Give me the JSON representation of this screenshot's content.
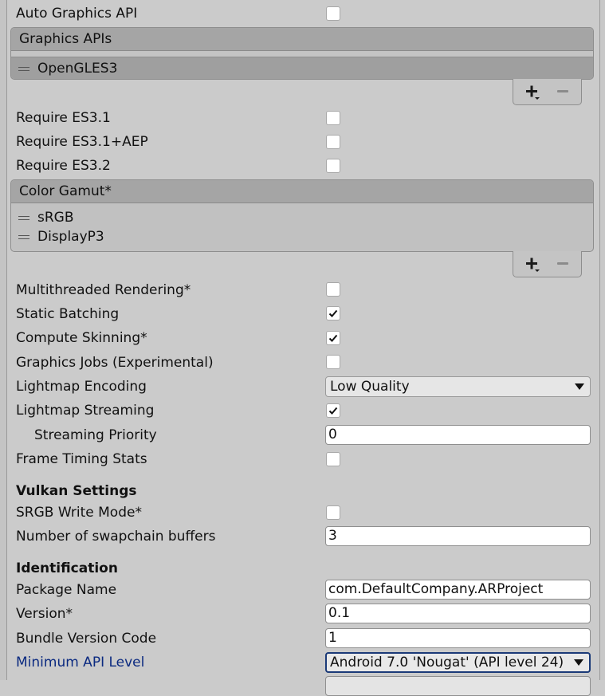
{
  "rows": {
    "auto_graphics_api": {
      "label": "Auto Graphics API",
      "checked": false
    },
    "require_es31": {
      "label": "Require ES3.1",
      "checked": false
    },
    "require_es31_aep": {
      "label": "Require ES3.1+AEP",
      "checked": false
    },
    "require_es32": {
      "label": "Require ES3.2",
      "checked": false
    },
    "multithreaded_rendering": {
      "label": "Multithreaded Rendering*",
      "checked": false
    },
    "static_batching": {
      "label": "Static Batching",
      "checked": true
    },
    "compute_skinning": {
      "label": "Compute Skinning*",
      "checked": true
    },
    "graphics_jobs": {
      "label": "Graphics Jobs (Experimental)",
      "checked": false
    },
    "lightmap_encoding": {
      "label": "Lightmap Encoding",
      "value": "Low Quality"
    },
    "lightmap_streaming": {
      "label": "Lightmap Streaming",
      "checked": true
    },
    "streaming_priority": {
      "label": "Streaming Priority",
      "value": "0"
    },
    "frame_timing_stats": {
      "label": "Frame Timing Stats",
      "checked": false
    }
  },
  "graphics_apis": {
    "header": "Graphics APIs",
    "items": [
      "OpenGLES3"
    ],
    "add_icon": "plus-dropdown-icon",
    "remove_icon": "minus-icon"
  },
  "color_gamut": {
    "header": "Color Gamut*",
    "items": [
      "sRGB",
      "DisplayP3"
    ],
    "add_icon": "plus-dropdown-icon",
    "remove_icon": "minus-icon"
  },
  "vulkan": {
    "heading": "Vulkan Settings",
    "srgb_write_mode": {
      "label": "SRGB Write Mode*",
      "checked": false
    },
    "swapchain_buffers": {
      "label": "Number of swapchain buffers",
      "value": "3"
    }
  },
  "identification": {
    "heading": "Identification",
    "package_name": {
      "label": "Package Name",
      "value": "com.DefaultCompany.ARProject"
    },
    "version": {
      "label": "Version*",
      "value": "0.1"
    },
    "bundle_version_code": {
      "label": "Bundle Version Code",
      "value": "1"
    },
    "minimum_api_level": {
      "label": "Minimum API Level",
      "value": "Android 7.0 'Nougat' (API level 24)"
    }
  },
  "colors": {
    "panel_bg": "#cbcbcb",
    "list_header_bg": "#a5a5a5",
    "selected_item_bg": "#9f9f9f",
    "link_label": "#0b2a80",
    "focus_border": "#1b3a78"
  }
}
